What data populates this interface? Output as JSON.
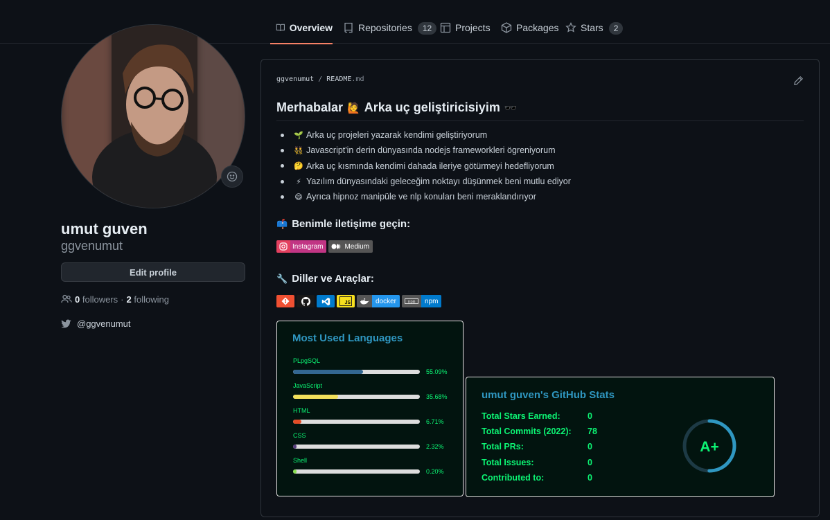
{
  "nav": {
    "tabs": [
      {
        "label": "Overview",
        "icon": "book-icon"
      },
      {
        "label": "Repositories",
        "count": "12",
        "icon": "repo-icon"
      },
      {
        "label": "Projects",
        "icon": "table-icon"
      },
      {
        "label": "Packages",
        "icon": "package-icon"
      },
      {
        "label": "Stars",
        "count": "2",
        "icon": "star-icon"
      }
    ]
  },
  "profile": {
    "full_name": "umut guven",
    "login": "ggvenumut",
    "edit_button": "Edit profile",
    "followers_count": "0",
    "followers_label": "followers",
    "separator": "·",
    "following_count": "2",
    "following_label": "following",
    "twitter": "@ggvenumut"
  },
  "readme": {
    "breadcrumb_user": "ggvenumut",
    "breadcrumb_sep": "/",
    "breadcrumb_file": "README",
    "breadcrumb_ext": ".md",
    "heading": "Merhabalar",
    "heading_emoji": "🙋",
    "heading_rest": "Arka uç geliştiricisiyim",
    "heading_emoji2": "🕶️",
    "bullets": [
      {
        "emoji": "🌱",
        "text": "Arka uç projeleri yazarak kendimi geliştiriyorum"
      },
      {
        "emoji": "👯",
        "text": "Javascript'in derin dünyasında nodejs frameworkleri ögreniyorum"
      },
      {
        "emoji": "🤔",
        "text": "Arka uç kısmında kendimi dahada ileriye götürmeyi hedefliyorum"
      },
      {
        "emoji": "⚡",
        "text": "Yazılım dünyasındaki geleceğim noktayı düşünmek beni mutlu ediyor"
      },
      {
        "emoji": "😄",
        "text": "Ayrıca hipnoz manipüle ve nlp konuları beni meraklandırıyor"
      }
    ],
    "contact_emoji": "📫",
    "contact_heading": "Benimle iletişime geçin:",
    "contact_badges": [
      {
        "label": "Instagram",
        "color": "#e4405f",
        "icon": "instagram-icon"
      },
      {
        "label": "Medium",
        "color": "#555555",
        "icon": "medium-icon"
      }
    ],
    "tools_emoji": "🔧",
    "tools_heading": "Diller ve Araçlar:",
    "tool_badges": [
      {
        "label": "",
        "color": "#f05032",
        "icon": "git-icon"
      },
      {
        "label": "",
        "color": "#181717",
        "icon": "github-icon"
      },
      {
        "label": "",
        "color": "#007acc",
        "icon": "vscode-icon"
      },
      {
        "label": "JS",
        "color": "#f7df1e",
        "icon": "javascript-icon"
      },
      {
        "label": "docker",
        "color": "#2496ed",
        "icon": "docker-icon"
      },
      {
        "label": "npm",
        "color": "#007acc",
        "icon": "npm-icon"
      }
    ]
  },
  "languages_card": {
    "title": "Most Used Languages",
    "languages": [
      {
        "name": "PLpgSQL",
        "percent": 55.09,
        "percent_label": "55.09%",
        "color": "#336791"
      },
      {
        "name": "JavaScript",
        "percent": 35.68,
        "percent_label": "35.68%",
        "color": "#f1e05a"
      },
      {
        "name": "HTML",
        "percent": 6.71,
        "percent_label": "6.71%",
        "color": "#e34c26"
      },
      {
        "name": "CSS",
        "percent": 2.32,
        "percent_label": "2.32%",
        "color": "#563d7c"
      },
      {
        "name": "Shell",
        "percent": 0.2,
        "percent_label": "0.20%",
        "color": "#89e051"
      }
    ]
  },
  "stats_card": {
    "title": "umut guven's GitHub Stats",
    "rows": [
      {
        "label": "Total Stars Earned:",
        "value": "0"
      },
      {
        "label": "Total Commits (2022):",
        "value": "78"
      },
      {
        "label": "Total PRs:",
        "value": "0"
      },
      {
        "label": "Total Issues:",
        "value": "0"
      },
      {
        "label": "Contributed to:",
        "value": "0"
      }
    ],
    "grade": "A+",
    "ring_progress": 0.5,
    "ring_color": "#2f97c1"
  }
}
